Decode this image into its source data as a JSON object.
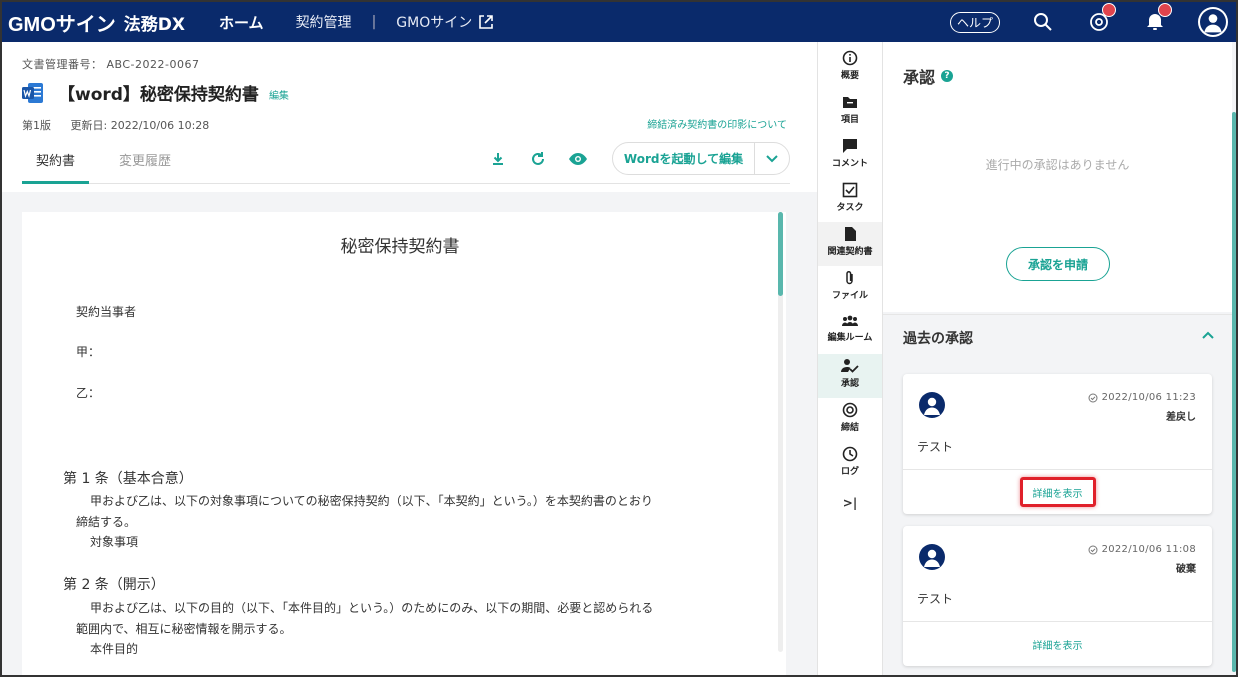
{
  "header": {
    "logo_main": "GMOサイン",
    "logo_sub": "法務DX",
    "nav_home": "ホーム",
    "nav_contracts": "契約管理",
    "nav_separator": "|",
    "nav_gmo": "GMOサイン",
    "help_label": "ヘルプ",
    "brand_color": "#0a2a6b",
    "badge_color": "#e0444d"
  },
  "document": {
    "number_label": "文書管理番号： ABC-2022-0067",
    "title": "【word】秘密保持契約書",
    "edit_label": "編集",
    "version": "第1版",
    "updated": "更新日: 2022/10/06 10:28",
    "stamp_link": "締結済み契約書の印影について",
    "tabs": [
      {
        "label": "契約書"
      },
      {
        "label": "変更履歴"
      }
    ],
    "word_button": "Wordを起動して編集",
    "accent_color": "#1aa394"
  },
  "paper": {
    "title": "秘密保持契約書",
    "parties_label": "契約当事者",
    "party_a": "甲：",
    "party_b": "乙：",
    "art1_title": "第 1 条（基本合意）",
    "art1_line1": "甲および乙は、以下の対象事項についての秘密保持契約（以下、「本契約」という。）を本契約書のとおり",
    "art1_line2": "締結する。",
    "art1_line3": "対象事項",
    "art2_title": "第 2 条（開示）",
    "art2_line1": "甲および乙は、以下の目的（以下、「本件目的」という。）のためにのみ、以下の期間、必要と認められる",
    "art2_line2": "範囲内で、相互に秘密情報を開示する。",
    "art2_line3": "本件目的"
  },
  "rail": {
    "items": [
      {
        "label": "概要",
        "icon": "info-icon"
      },
      {
        "label": "項目",
        "icon": "folder-icon"
      },
      {
        "label": "コメント",
        "icon": "comment-icon"
      },
      {
        "label": "タスク",
        "icon": "task-icon"
      },
      {
        "label": "関連契約書",
        "icon": "file-icon"
      },
      {
        "label": "ファイル",
        "icon": "paperclip-icon"
      },
      {
        "label": "編集ルーム",
        "icon": "group-icon"
      },
      {
        "label": "承認",
        "icon": "approval-icon"
      },
      {
        "label": "締結",
        "icon": "target-icon"
      },
      {
        "label": "ログ",
        "icon": "clock-icon"
      }
    ],
    "collapse_label": ">|"
  },
  "approval": {
    "title": "承認",
    "help_mark": "?",
    "empty_text": "進行中の承認はありません",
    "apply_button": "承認を申請",
    "past_title": "過去の承認",
    "cards": [
      {
        "date": "2022/10/06 11:23",
        "status": "差戻し",
        "comment": "テスト",
        "link": "詳細を表示"
      },
      {
        "date": "2022/10/06 11:08",
        "status": "破棄",
        "comment": "テスト",
        "link": "詳細を表示"
      }
    ],
    "highlight_color": "#e0202a"
  }
}
